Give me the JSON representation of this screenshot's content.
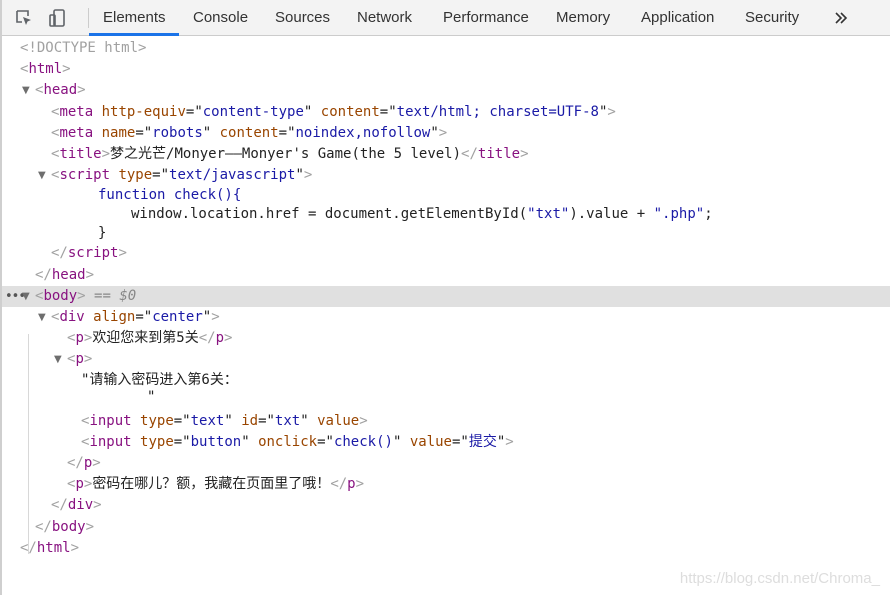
{
  "toolbar": {
    "tabs": [
      "Elements",
      "Console",
      "Sources",
      "Network",
      "Performance",
      "Memory",
      "Application",
      "Security"
    ],
    "active_tab": "Elements",
    "overflow": "»",
    "icons": [
      "inspect-element-icon",
      "device-toolbar-icon",
      "more-tabs-icon"
    ],
    "accent_color": "#1a73e8"
  },
  "dom": {
    "doctype": "<!DOCTYPE html>",
    "html_open": "html",
    "head_open": "head",
    "meta1": {
      "tag": "meta",
      "attr1_name": "http-equiv",
      "attr1_value": "content-type",
      "attr2_name": "content",
      "attr2_value": "text/html; charset=UTF-8"
    },
    "meta2": {
      "tag": "meta",
      "attr1_name": "name",
      "attr1_value": "robots",
      "attr2_name": "content",
      "attr2_value": "noindex,nofollow"
    },
    "title": {
      "tag": "title",
      "text": "梦之光芒/Monyer——Monyer's Game(the 5 level)"
    },
    "script": {
      "tag": "script",
      "attr_name": "type",
      "attr_value": "text/javascript",
      "code_line1": "function check(){",
      "code_line2_a": "window.location.href = document.getElementById(",
      "code_line2_str1": "\"txt\"",
      "code_line2_b": ").value + ",
      "code_line2_str2": "\".php\"",
      "code_line2_c": ";",
      "code_line3": "}"
    },
    "body": {
      "tag": "body",
      "eq_marker": "== $0"
    },
    "div": {
      "tag": "div",
      "attr_name": "align",
      "attr_value": "center"
    },
    "p1": {
      "tag": "p",
      "text": "欢迎您来到第5关"
    },
    "p2": {
      "tag": "p",
      "text_line1": "\"请输入密码进入第6关：",
      "text_line2": "\""
    },
    "input1": {
      "tag": "input",
      "attr1_name": "type",
      "attr1_value": "text",
      "attr2_name": "id",
      "attr2_value": "txt",
      "attr3_name": "value"
    },
    "input2": {
      "tag": "input",
      "attr1_name": "type",
      "attr1_value": "button",
      "attr2_name": "onclick",
      "attr2_value": "check()",
      "attr3_name": "value",
      "attr3_value": "提交"
    },
    "p3": {
      "tag": "p",
      "text": "密码在哪儿？额，我藏在页面里了哦！"
    },
    "close_div": "div",
    "close_body": "body",
    "close_html": "html",
    "close_head": "head",
    "close_script": "script",
    "close_p": "p"
  },
  "watermark": "https://blog.csdn.net/Chroma_"
}
